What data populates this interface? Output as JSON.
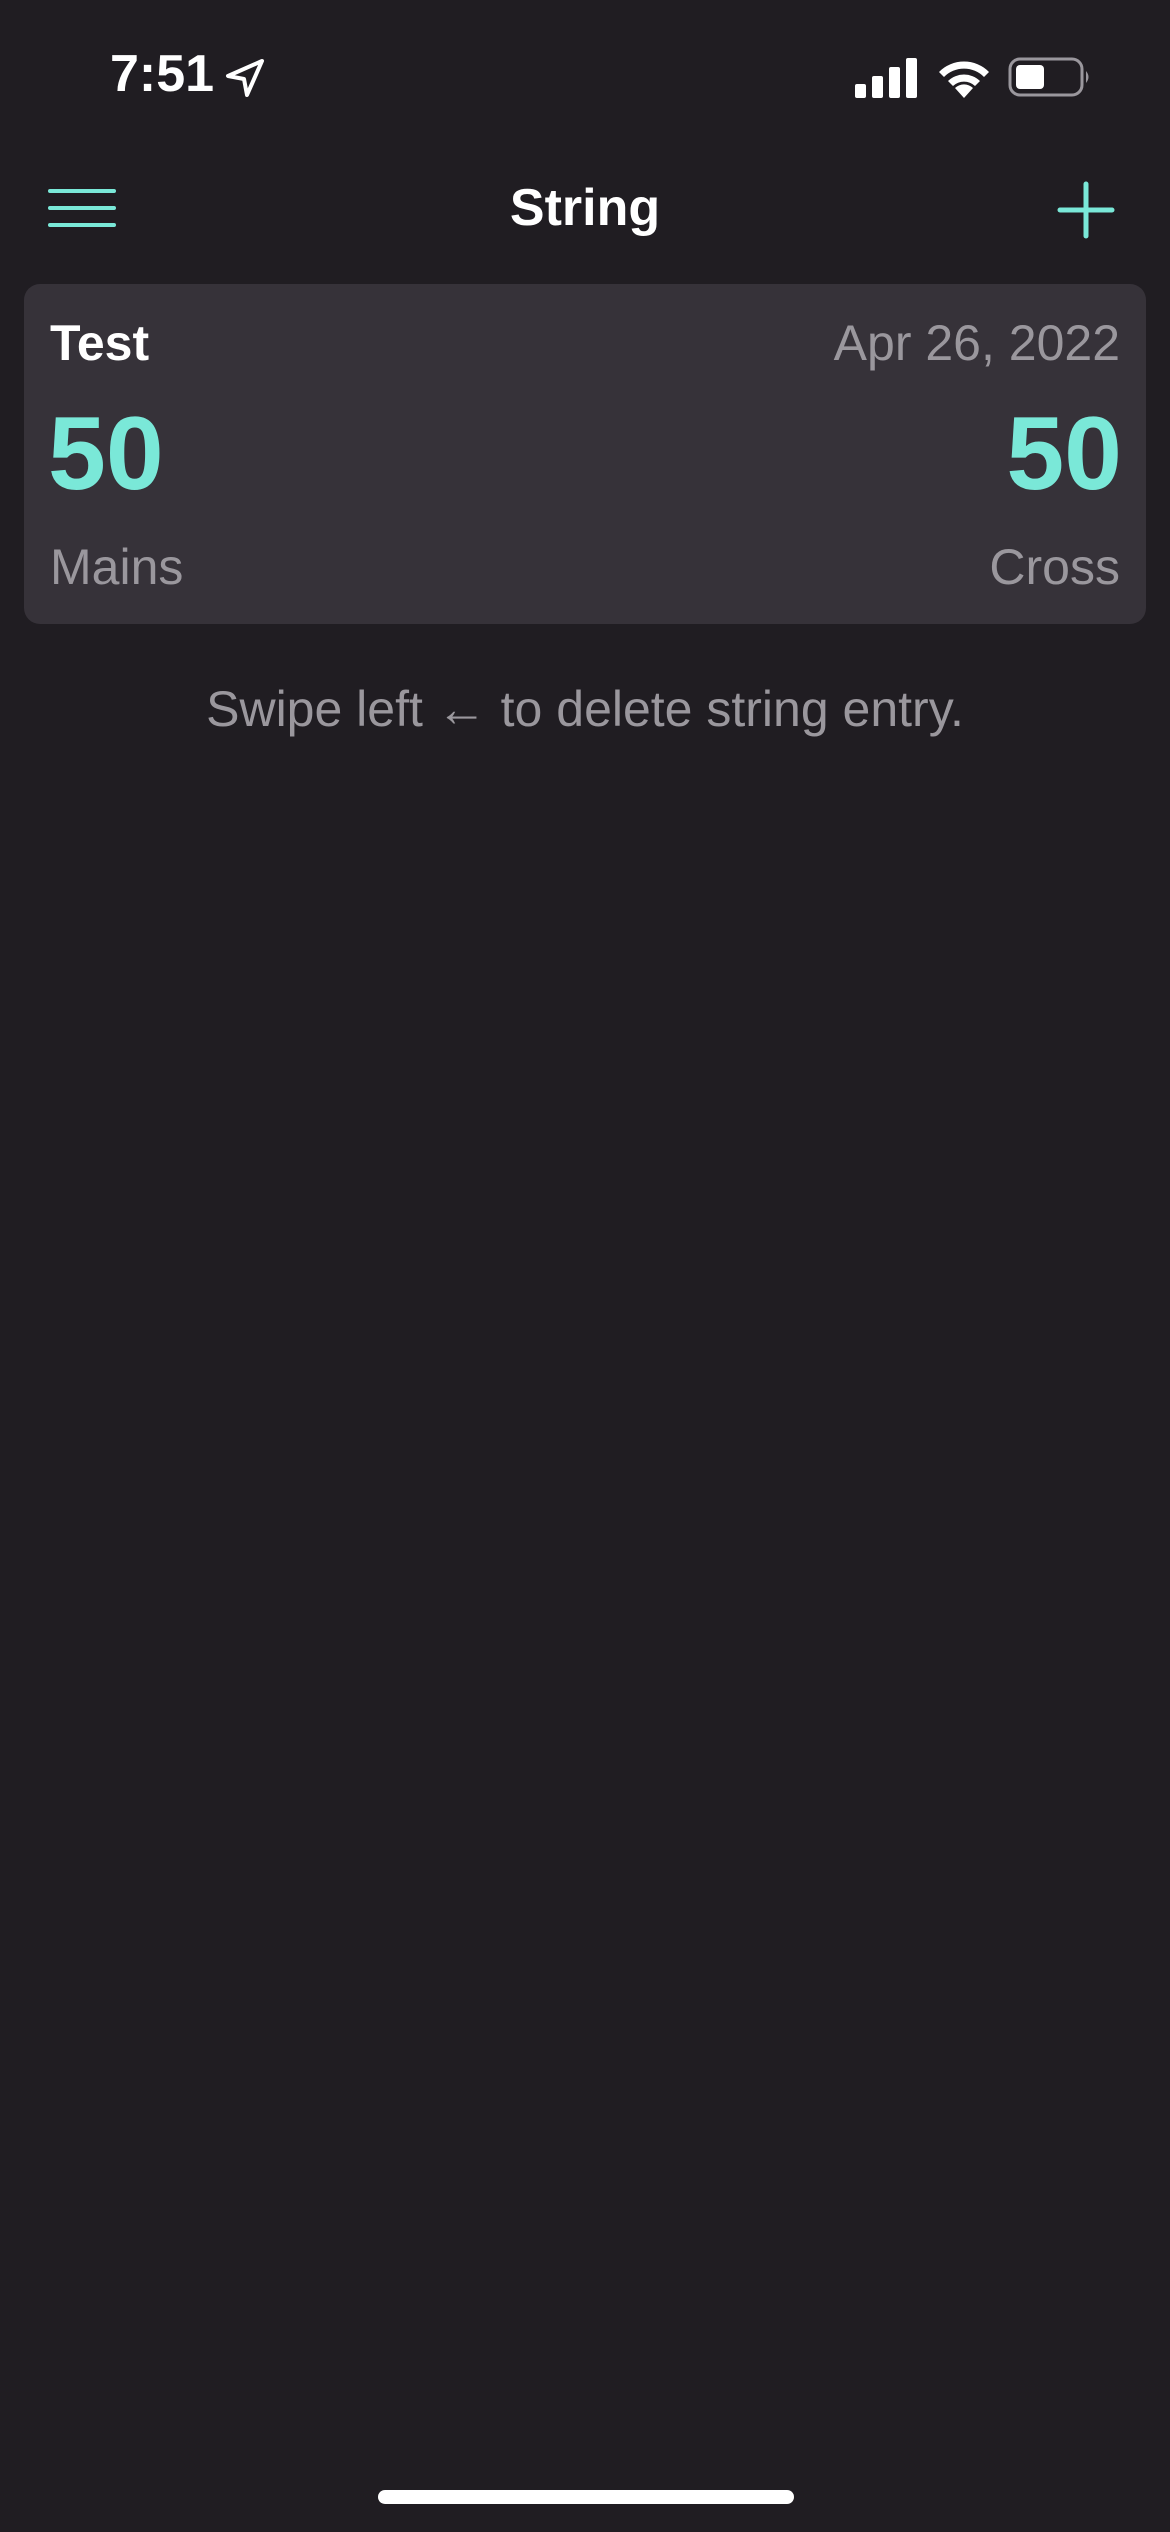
{
  "status_bar": {
    "time": "7:51",
    "icons": [
      "location-arrow-icon",
      "signal-bars-icon",
      "wifi-icon",
      "battery-icon"
    ]
  },
  "nav": {
    "title": "String",
    "menu_icon": "hamburger-menu-icon",
    "add_icon": "plus-icon"
  },
  "entries": [
    {
      "name": "Test",
      "date": "Apr 26, 2022",
      "mains_value": "50",
      "mains_label": "Mains",
      "cross_value": "50",
      "cross_label": "Cross"
    }
  ],
  "hint": "Swipe left ← to delete string entry.",
  "colors": {
    "background": "#201d22",
    "card": "#363239",
    "accent": "#7ae8d8",
    "secondary_text": "#9a979d"
  }
}
